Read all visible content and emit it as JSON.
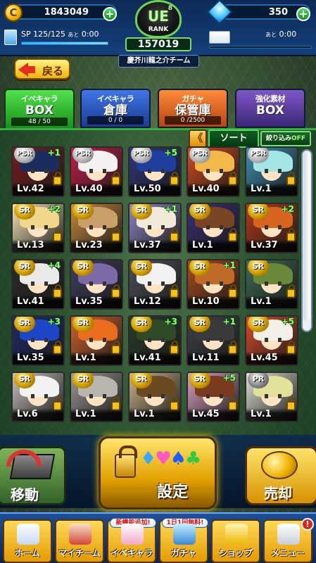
{
  "header": {
    "coins": "1843049",
    "gems": "350",
    "sp_label": "SP",
    "sp_value": "125/125",
    "sp_timer_prefix": "あと",
    "sp_timer": "0:00",
    "ticket_timer_prefix": "あと",
    "ticket_timer": "0:00",
    "rank_code": "UE",
    "rank_small": "8",
    "rank_word": "RANK",
    "rank_number": "157019",
    "team_name": "慶芥川龍之介チーム",
    "back_label": "戻る"
  },
  "tabs": [
    {
      "top": "イベキャラ",
      "big": "BOX",
      "count": "48 / 50"
    },
    {
      "top": "イベキャラ",
      "big": "倉庫",
      "count": "0 / 0"
    },
    {
      "top": "ガチャ",
      "big": "保管庫",
      "count": "0 /2500"
    },
    {
      "top": "強化素材",
      "big": "BOX",
      "count": ""
    }
  ],
  "sort": {
    "chevron": "《",
    "sort_label": "ソート",
    "filter_label": "絞り込み",
    "filter_state": "OFF"
  },
  "cards": [
    {
      "rarity": "PSR",
      "plus": "+1",
      "level": "Lv.42",
      "hair": "#1d2c5e",
      "bg": "#7a1d1d"
    },
    {
      "rarity": "PSR",
      "plus": "",
      "level": "Lv.40",
      "hair": "#f4f1f0",
      "bg": "#c81d4a"
    },
    {
      "rarity": "PSR",
      "plus": "+5",
      "level": "Lv.50",
      "hair": "#1f3f9e",
      "bg": "#31357a"
    },
    {
      "rarity": "PSR",
      "plus": "",
      "level": "Lv.40",
      "hair": "#f2b84a",
      "bg": "#d64a1f"
    },
    {
      "rarity": "PSR",
      "plus": "",
      "level": "Lv.1",
      "hair": "#a4e6e6",
      "bg": "#3f8fb0"
    },
    {
      "rarity": "SR",
      "plus": "+2",
      "level": "Lv.13",
      "hair": "#f0d68a",
      "bg": "#f3e3b4"
    },
    {
      "rarity": "SR",
      "plus": "",
      "level": "Lv.23",
      "hair": "#caa06a",
      "bg": "#c98c3b"
    },
    {
      "rarity": "SR",
      "plus": "+1",
      "level": "Lv.37",
      "hair": "#f2ead8",
      "bg": "#8d86c5"
    },
    {
      "rarity": "SR",
      "plus": "",
      "level": "Lv.1",
      "hair": "#7a4525",
      "bg": "#3a2e75"
    },
    {
      "rarity": "SR",
      "plus": "+2",
      "level": "Lv.37",
      "hair": "#d7641f",
      "bg": "#b33a1a"
    },
    {
      "rarity": "SR",
      "plus": "+4",
      "level": "Lv.41",
      "hair": "#ebe9e8",
      "bg": "#2a2a2a"
    },
    {
      "rarity": "SR",
      "plus": "",
      "level": "Lv.35",
      "hair": "#7b6aa6",
      "bg": "#3f3f60"
    },
    {
      "rarity": "SR",
      "plus": "",
      "level": "Lv.12",
      "hair": "#f1f1f1",
      "bg": "#4b5158"
    },
    {
      "rarity": "SR",
      "plus": "+1",
      "level": "Lv.10",
      "hair": "#c06a2a",
      "bg": "#a84a1f"
    },
    {
      "rarity": "SR",
      "plus": "",
      "level": "Lv.1",
      "hair": "#6a8a3a",
      "bg": "#3d6a55"
    },
    {
      "rarity": "SR",
      "plus": "+3",
      "level": "Lv.35",
      "hair": "#1d47c8",
      "bg": "#1e2a66"
    },
    {
      "rarity": "SR",
      "plus": "",
      "level": "Lv.1",
      "hair": "#ea6d1f",
      "bg": "#d3652a"
    },
    {
      "rarity": "SR",
      "plus": "+3",
      "level": "Lv.41",
      "hair": "#2f4a27",
      "bg": "#2a3b2a"
    },
    {
      "rarity": "SR",
      "plus": "+1",
      "level": "Lv.11",
      "hair": "#3a3a3a",
      "bg": "#3d4144"
    },
    {
      "rarity": "SR",
      "plus": "+5",
      "level": "Lv.45",
      "hair": "#f2efe6",
      "bg": "#d94a2a"
    },
    {
      "rarity": "SR",
      "plus": "",
      "level": "Lv.6",
      "hair": "#f2f2f2",
      "bg": "#c6c2bf"
    },
    {
      "rarity": "SR",
      "plus": "",
      "level": "Lv.1",
      "hair": "#b9b6b0",
      "bg": "#9c9a96"
    },
    {
      "rarity": "SR",
      "plus": "",
      "level": "Lv.1",
      "hair": "#6a4a22",
      "bg": "#c9b28a"
    },
    {
      "rarity": "SR",
      "plus": "+5",
      "level": "Lv.45",
      "hair": "#7a3a1e",
      "bg": "#d9a0c0"
    },
    {
      "rarity": "PR",
      "plus": "",
      "level": "Lv.1",
      "hair": "#e3e09a",
      "bg": "#dfe3d2"
    }
  ],
  "actions": {
    "move_label": "移動",
    "set_label": "設定",
    "sell_label": "売却",
    "suits": [
      "♦",
      "♥",
      "♠",
      "♣"
    ]
  },
  "nav": [
    {
      "label": "ホーム",
      "tag": ""
    },
    {
      "label": "マイチーム",
      "tag": ""
    },
    {
      "label": "イベキャラ",
      "tag": "新機能追加!"
    },
    {
      "label": "ガチャ",
      "tag": "1日1回無料!"
    },
    {
      "label": "ショップ",
      "tag": ""
    },
    {
      "label": "メニュー",
      "tag": ""
    }
  ],
  "menu_badge": "!",
  "colors": {
    "active_tab": "#2bbd2f",
    "level_text": "#ffffff",
    "plus_text": "#9dff58",
    "gold": "#f0b300"
  }
}
